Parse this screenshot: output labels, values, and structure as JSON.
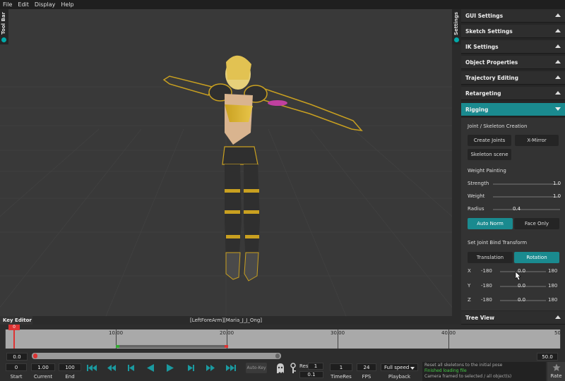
{
  "menu": [
    "File",
    "Edit",
    "Display",
    "Help"
  ],
  "toolbar_tab": "Tool Bar",
  "settings_tab": "Settings",
  "panel": {
    "sections": [
      "GUI Settings",
      "Sketch Settings",
      "IK Settings",
      "Object Properties",
      "Trajectory Editing",
      "Retargeting",
      "Rigging"
    ],
    "tree_view": "Tree View",
    "rigging": {
      "joint_heading": "Joint / Skeleton Creation",
      "create_joints": "Create Joints",
      "x_mirror": "X-Mirror",
      "skeleton_scene": "Skeleton scene",
      "weight_heading": "Weight Painting",
      "strength_label": "Strength",
      "strength_value": "1.0",
      "weight_label": "Weight",
      "weight_value": "1.0",
      "radius_label": "Radius",
      "radius_value": "0.4",
      "auto_norm": "Auto Norm",
      "face_only": "Face Only",
      "bind_heading": "Set Joint Bind Transform",
      "translation": "Translation",
      "rotation": "Rotation",
      "axes": [
        {
          "label": "X",
          "min": "-180",
          "value": "0.0",
          "max": "180"
        },
        {
          "label": "Y",
          "min": "-180",
          "value": "0.0",
          "max": "180"
        },
        {
          "label": "Z",
          "min": "-180",
          "value": "0.0",
          "max": "180"
        }
      ]
    }
  },
  "viewport_caption": "[LeftForeArm][Maria_J_J_Ong]",
  "key_editor": "Key Editor",
  "ruler": {
    "marker": "0",
    "labels": [
      "10.00",
      "20.00",
      "30.00",
      "40.00",
      "50"
    ]
  },
  "range": {
    "start": "0.0",
    "end": "50.0"
  },
  "controls": {
    "start": "0",
    "start_label": "Start",
    "current": "1.00",
    "current_label": "Current",
    "end": "100",
    "end_label": "End",
    "auto_key": "Auto-Key",
    "res_label": "Res",
    "res_value": "1",
    "res_value2": "0.1",
    "time_res": "1",
    "time_res_label": "TimeRes",
    "fps": "24",
    "fps_label": "FPS",
    "playback": "Full speed",
    "playback_label": "Playback",
    "rate_label": "Rate"
  },
  "log": [
    "Reset all skeletons to the initial pose",
    "Finished loading file",
    "Camera framed to selected / all object(s)"
  ]
}
